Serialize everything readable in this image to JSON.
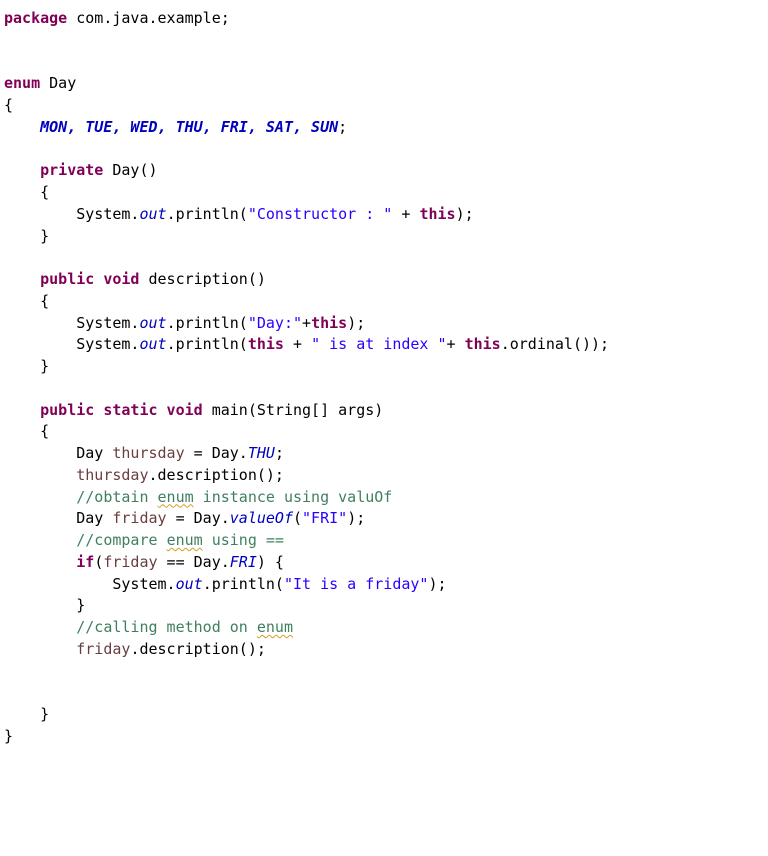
{
  "code": {
    "l1_package": "package",
    "l1_pkg": " com.java.example;",
    "l3_enum": "enum",
    "l3_name": " Day",
    "l5_consts": "MON, TUE, WED, THU, FRI, SAT, SUN",
    "l7_private": "private",
    "l7_name": " Day()",
    "l9_sys": "System.",
    "l9_out": "out",
    "l9_print": ".println(",
    "l9_str": "\"Constructor : \"",
    "l9_plus": " + ",
    "l9_this": "this",
    "l9_end": ");",
    "l12_public": "public",
    "l12_void": " void",
    "l12_name": " description()",
    "l14_sys": "System.",
    "l14_out": "out",
    "l14_print": ".println(",
    "l14_str": "\"Day:\"",
    "l14_plus": "+",
    "l14_this": "this",
    "l14_end": ");",
    "l15_sys": "System.",
    "l15_out": "out",
    "l15_print": ".println(",
    "l15_this": "this",
    "l15_plus1": " + ",
    "l15_str": "\" is at index \"",
    "l15_plus2": "+ ",
    "l15_this2": "this",
    "l15_call": ".ordinal());",
    "l18_public": "public",
    "l18_static": " static",
    "l18_void": " void",
    "l18_name": " main(String[] args)",
    "l20_type": "Day ",
    "l20_var": "thursday",
    "l20_eq": " = Day.",
    "l20_thu": "THU",
    "l20_end": ";",
    "l21_var": "thursday",
    "l21_call": ".description();",
    "l22_c1": "//obtain ",
    "l22_w": "enum",
    "l22_c2": " instance using valuOf",
    "l23_type": "Day ",
    "l23_var": "friday",
    "l23_eq": " = Day.",
    "l23_m": "valueOf",
    "l23_p": "(",
    "l23_str": "\"FRI\"",
    "l23_end": ");",
    "l24_c1": "//compare ",
    "l24_w": "enum",
    "l24_c2": " using ==",
    "l25_if": "if",
    "l25_p": "(",
    "l25_var": "friday",
    "l25_eq": " == Day.",
    "l25_fri": "FRI",
    "l25_end": ") {",
    "l26_sys": "System.",
    "l26_out": "out",
    "l26_print": ".println(",
    "l26_str": "\"It is a friday\"",
    "l26_end": ");",
    "l28_c1": "//calling method on ",
    "l28_w": "enum",
    "l29_var": "friday",
    "l29_call": ".description();"
  }
}
